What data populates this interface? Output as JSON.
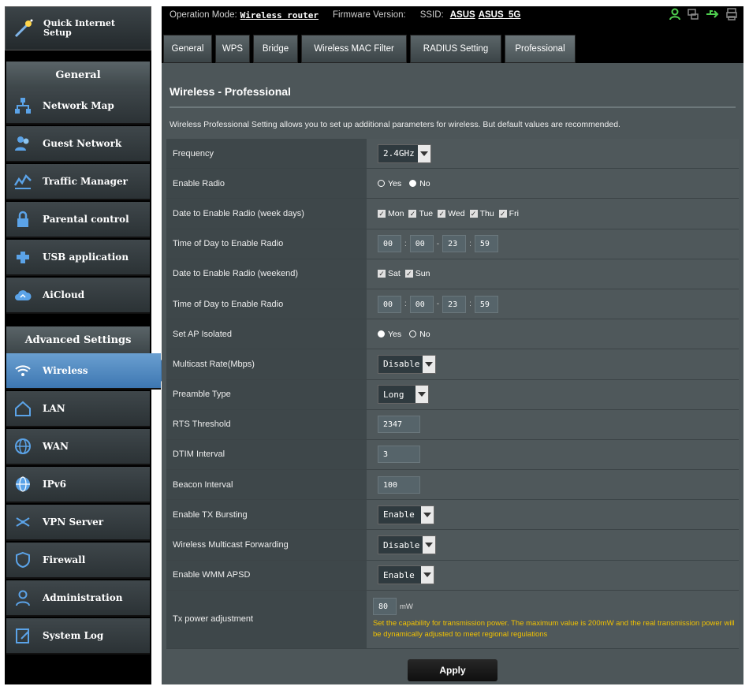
{
  "header": {
    "op_mode_label": "Operation Mode:",
    "op_mode_value": "Wireless router",
    "firmware_label": "Firmware Version:",
    "ssid_label": "SSID:",
    "ssid_1": "ASUS",
    "ssid_2": "ASUS_5G",
    "status_icons": [
      "user-icon",
      "network-icon",
      "usb-icon",
      "printer-icon"
    ]
  },
  "sidebar": {
    "qis_label": "Quick Internet Setup",
    "general_heading": "General",
    "general_items": [
      {
        "label": "Network Map",
        "icon": "network-map-icon"
      },
      {
        "label": "Guest Network",
        "icon": "guest-network-icon"
      },
      {
        "label": "Traffic Manager",
        "icon": "traffic-manager-icon"
      },
      {
        "label": "Parental control",
        "icon": "parental-control-icon"
      },
      {
        "label": "USB application",
        "icon": "usb-application-icon"
      },
      {
        "label": "AiCloud",
        "icon": "aicloud-icon"
      }
    ],
    "advanced_heading": "Advanced Settings",
    "advanced_items": [
      {
        "label": "Wireless",
        "icon": "wireless-icon"
      },
      {
        "label": "LAN",
        "icon": "lan-icon"
      },
      {
        "label": "WAN",
        "icon": "wan-icon"
      },
      {
        "label": "IPv6",
        "icon": "ipv6-icon"
      },
      {
        "label": "VPN Server",
        "icon": "vpn-server-icon"
      },
      {
        "label": "Firewall",
        "icon": "firewall-icon"
      },
      {
        "label": "Administration",
        "icon": "administration-icon"
      },
      {
        "label": "System Log",
        "icon": "system-log-icon"
      }
    ]
  },
  "tabs": [
    "General",
    "WPS",
    "Bridge",
    "Wireless MAC Filter",
    "RADIUS Setting",
    "Professional"
  ],
  "panel": {
    "title": "Wireless - Professional",
    "description": "Wireless Professional Setting allows you to set up additional parameters for wireless. But default values are recommended.",
    "rows": {
      "frequency": {
        "label": "Frequency",
        "value": "2.4GHz"
      },
      "enable_radio": {
        "label": "Enable Radio",
        "yes": "Yes",
        "no": "No"
      },
      "date_weekdays": {
        "label": "Date to Enable Radio (week days)",
        "days": [
          "Mon",
          "Tue",
          "Wed",
          "Thu",
          "Fri"
        ]
      },
      "time_weekdays": {
        "label": "Time of Day to Enable Radio",
        "values": [
          "00",
          "00",
          "23",
          "59"
        ]
      },
      "date_weekend": {
        "label": "Date to Enable Radio (weekend)",
        "days": [
          "Sat",
          "Sun"
        ]
      },
      "time_weekend": {
        "label": "Time of Day to Enable Radio",
        "values": [
          "00",
          "00",
          "23",
          "59"
        ]
      },
      "ap_isolated": {
        "label": "Set AP Isolated",
        "yes": "Yes",
        "no": "No"
      },
      "multicast_rate": {
        "label": "Multicast Rate(Mbps)",
        "value": "Disable"
      },
      "preamble": {
        "label": "Preamble Type",
        "value": "Long"
      },
      "rts": {
        "label": "RTS Threshold",
        "value": "2347"
      },
      "dtim": {
        "label": "DTIM Interval",
        "value": "3"
      },
      "beacon": {
        "label": "Beacon Interval",
        "value": "100"
      },
      "tx_bursting": {
        "label": "Enable TX Bursting",
        "value": "Enable"
      },
      "multicast_fwd": {
        "label": "Wireless Multicast Forwarding",
        "value": "Disable"
      },
      "wmm_apsd": {
        "label": "Enable WMM APSD",
        "value": "Enable"
      },
      "tx_power": {
        "label": "Tx power adjustment",
        "value": "80",
        "unit": "mW",
        "note": "Set the capability for transmission power. The maximum value is 200mW and the real transmission power will be dynamically adjusted to meet regional regulations"
      }
    },
    "apply_label": "Apply"
  }
}
